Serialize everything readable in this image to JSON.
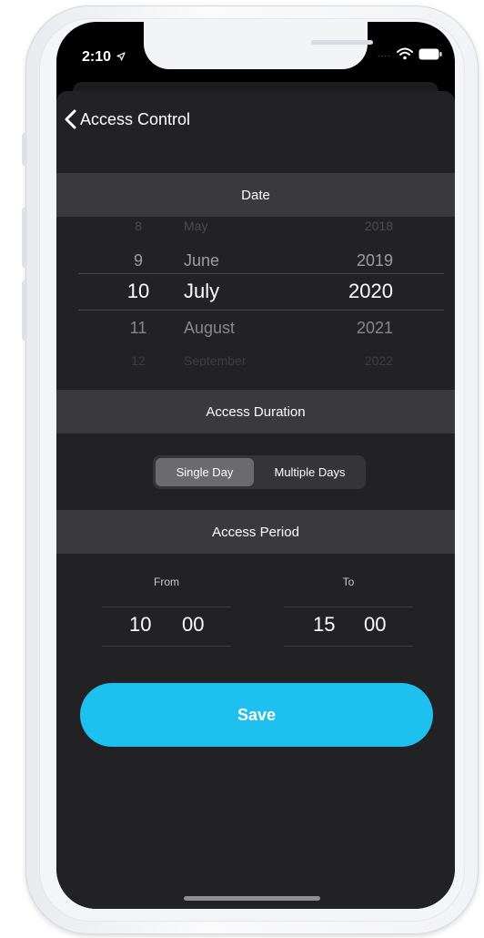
{
  "status": {
    "time": "2:10"
  },
  "nav": {
    "back_label": "Access Control"
  },
  "sections": {
    "date": "Date",
    "duration": "Access Duration",
    "period": "Access Period"
  },
  "date_picker": {
    "rows": [
      {
        "day": "8",
        "month": "May",
        "year": "2018",
        "opacity": 0.18,
        "size": 14
      },
      {
        "day": "9",
        "month": "June",
        "year": "2019",
        "opacity": 0.55,
        "size": 18
      },
      {
        "day": "10",
        "month": "July",
        "year": "2020",
        "opacity": 1.0,
        "size": 22
      },
      {
        "day": "11",
        "month": "August",
        "year": "2021",
        "opacity": 0.45,
        "size": 18
      },
      {
        "day": "12",
        "month": "September",
        "year": "2022",
        "opacity": 0.12,
        "size": 14
      }
    ]
  },
  "duration": {
    "single_day": "Single Day",
    "multiple_days": "Multiple Days"
  },
  "period": {
    "from_label": "From",
    "from_hour": "10",
    "from_minute": "00",
    "to_label": "To",
    "to_hour": "15",
    "to_minute": "00"
  },
  "save_label": "Save",
  "colors": {
    "accent": "#1ec0ef",
    "sheet": "#222225",
    "header": "#3a3a3d"
  },
  "icons": {
    "back": "chevron-left-icon",
    "location": "location-arrow-icon",
    "wifi": "wifi-icon",
    "battery": "battery-icon"
  }
}
